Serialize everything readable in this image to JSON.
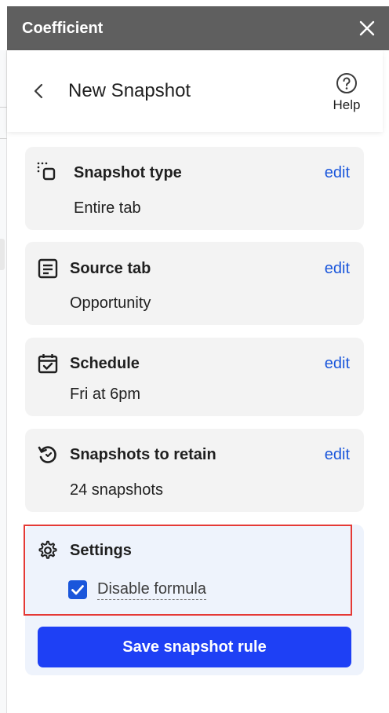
{
  "titlebar": {
    "app_title": "Coefficient"
  },
  "header": {
    "page_title": "New Snapshot",
    "help_label": "Help"
  },
  "cards": [
    {
      "title": "Snapshot type",
      "value": "Entire tab",
      "edit_label": "edit",
      "icon": "snapshot-type-icon"
    },
    {
      "title": "Source tab",
      "value": "Opportunity",
      "edit_label": "edit",
      "icon": "source-tab-icon"
    },
    {
      "title": "Schedule",
      "value": "Fri at 6pm",
      "edit_label": "edit",
      "icon": "calendar-icon"
    },
    {
      "title": "Snapshots to retain",
      "value": "24 snapshots",
      "edit_label": "edit",
      "icon": "refresh-icon"
    }
  ],
  "settings": {
    "title": "Settings",
    "disable_formula_label": "Disable formula",
    "disable_formula_checked": true
  },
  "actions": {
    "save_label": "Save snapshot rule"
  },
  "colors": {
    "titlebar_bg": "#5f5f5f",
    "link_blue": "#1a56db",
    "primary_button": "#1e40f5",
    "highlight_border": "#e53935",
    "card_bg": "#f3f3f3",
    "settings_bg": "#eef3fc"
  }
}
